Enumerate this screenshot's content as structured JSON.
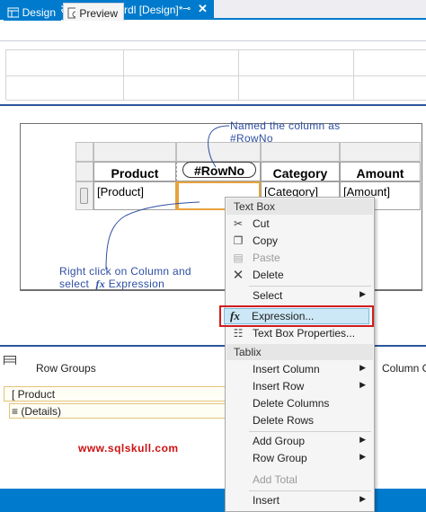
{
  "document_tab": {
    "title": "RptDemo_RNoByGroup.rdl [Design]*",
    "pin": "⊸",
    "close": "✕"
  },
  "view_tabs": {
    "design": "Design",
    "preview": "Preview"
  },
  "tablix": {
    "headers": [
      "Product",
      "#RowNo",
      "Category",
      "Amount"
    ],
    "row": [
      "[Product]",
      "",
      "[Category]",
      "[Amount]"
    ]
  },
  "annotations": {
    "named_line1": "Named the column as",
    "named_line2": "#RowNo",
    "right_click_line1": "Right click on Column and",
    "right_click_line2_pre": "select",
    "right_click_fx": "fx",
    "right_click_line2_post": "Expression"
  },
  "groups": {
    "row_groups_label": "Row Groups",
    "column_groups_label": "Column G",
    "items": [
      "[ Product",
      "≡ (Details)"
    ]
  },
  "watermark": "www.sqlskull.com",
  "context_menu": {
    "section_textbox": "Text Box",
    "cut": "Cut",
    "copy": "Copy",
    "paste": "Paste",
    "delete": "Delete",
    "select": "Select",
    "expression": "Expression...",
    "textbox_properties": "Text Box Properties...",
    "section_tablix": "Tablix",
    "insert_column": "Insert Column",
    "insert_row": "Insert Row",
    "delete_columns": "Delete Columns",
    "delete_rows": "Delete Rows",
    "add_group": "Add Group",
    "row_group": "Row Group",
    "add_total": "Add Total",
    "insert": "Insert",
    "fx_icon": "fx"
  },
  "colors": {
    "accent": "#007acc",
    "annotation": "#2f4fa3",
    "highlight_border": "#d11c1c",
    "watermark": "#cc1111"
  }
}
